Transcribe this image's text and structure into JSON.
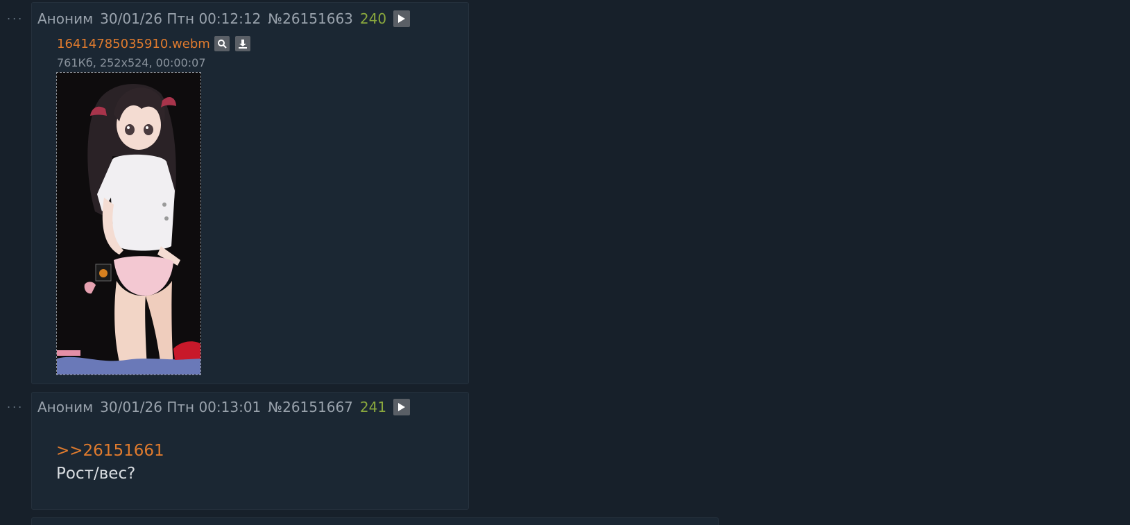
{
  "posts": [
    {
      "menu": "...",
      "name": "Аноним",
      "date": "30/01/26 Птн 00:12:12",
      "number": "№26151663",
      "count": "240",
      "file": {
        "name": "16414785035910.webm",
        "meta": "761Кб, 252x524, 00:00:07"
      }
    },
    {
      "menu": "...",
      "name": "Аноним",
      "date": "30/01/26 Птн 00:13:01",
      "number": "№26151667",
      "count": "241",
      "reply_link": ">>26151661",
      "text": "Рост/вес?"
    }
  ],
  "colors": {
    "background": "#17202a",
    "post_background": "#1b2733",
    "accent_orange": "#e07b2e",
    "count_green": "#8aa83d",
    "muted_text": "#9aa3ad"
  }
}
